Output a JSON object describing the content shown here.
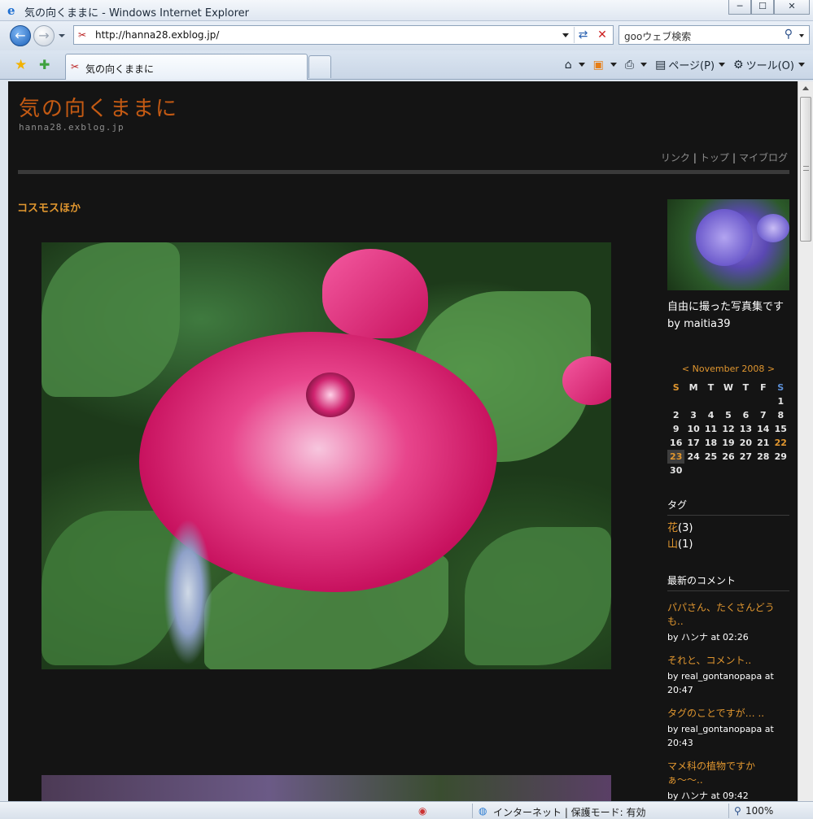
{
  "window": {
    "title": "気の向くままに - Windows Internet Explorer",
    "minimize": "─",
    "maximize": "☐",
    "close": "✕"
  },
  "address": {
    "url": "http://hanna28.exblog.jp/",
    "search_placeholder": "gooウェブ検索"
  },
  "tab": {
    "label": "気の向くままに"
  },
  "commands": {
    "page": "ページ(P)",
    "tools": "ツール(O)"
  },
  "blog": {
    "title": "気の向くままに",
    "url": "hanna28.exblog.jp",
    "nav": [
      "リンク",
      "トップ",
      "マイブログ"
    ]
  },
  "post": {
    "title": "コスモスほか"
  },
  "sidebar": {
    "profile_text": "自由に撮った写真集です",
    "profile_by": "by maitia39",
    "calendar": {
      "header": "< November 2008 >",
      "days": [
        "S",
        "M",
        "T",
        "W",
        "T",
        "F",
        "S"
      ],
      "weeks": [
        [
          "",
          "",
          "",
          "",
          "",
          "",
          "1"
        ],
        [
          "2",
          "3",
          "4",
          "5",
          "6",
          "7",
          "8"
        ],
        [
          "9",
          "10",
          "11",
          "12",
          "13",
          "14",
          "15"
        ],
        [
          "16",
          "17",
          "18",
          "19",
          "20",
          "21",
          "22"
        ],
        [
          "23",
          "24",
          "25",
          "26",
          "27",
          "28",
          "29"
        ],
        [
          "30",
          "",
          "",
          "",
          "",
          "",
          ""
        ]
      ],
      "linked_days": [
        "22",
        "23"
      ],
      "today": "23"
    },
    "tags_head": "タグ",
    "tags": [
      {
        "name": "花",
        "count": "(3)"
      },
      {
        "name": "山",
        "count": "(1)"
      }
    ],
    "comments_head": "最新のコメント",
    "comments": [
      {
        "title": "パパさん、たくさんどうも..",
        "by": "by ハンナ at 02:26"
      },
      {
        "title": "それと、コメント..",
        "by": "by real_gontanopapa at 20:47"
      },
      {
        "title": "タグのことですが… ..",
        "by": "by real_gontanopapa at 20:43"
      },
      {
        "title": "マメ科の植物ですかぁ〜〜..",
        "by": "by ハンナ at 09:42"
      }
    ]
  },
  "status": {
    "zone": "インターネット | 保護モード: 有効",
    "zoom": "100%"
  }
}
